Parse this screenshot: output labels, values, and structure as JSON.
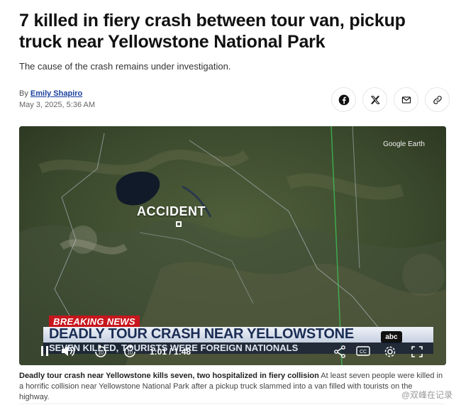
{
  "article": {
    "headline": "7 killed in fiery crash between tour van, pickup truck near Yellowstone National Park",
    "dek": "The cause of the crash remains under investigation.",
    "by_prefix": "By",
    "author": "Emily Shapiro",
    "date": "May 3, 2025, 5:36 AM"
  },
  "share": {
    "icons": [
      "facebook-icon",
      "x-icon",
      "email-icon",
      "link-icon"
    ]
  },
  "video": {
    "map_credit": "Google Earth",
    "accident_label": "ACCIDENT",
    "breaking_label": "BREAKING NEWS",
    "lower_third": "DEADLY TOUR CRASH NEAR YELLOWSTONE",
    "ticker": "SEVEN KILLED, TOURISTS WERE FOREIGN NATIONALS",
    "network_logo": "abc",
    "time_current": "1:01",
    "time_total": "1:48",
    "time_sep": " / ",
    "colors": {
      "breaking": "#c8161d",
      "lower_third_text": "#1b2d55"
    }
  },
  "caption": {
    "title": "Deadly tour crash near Yellowstone kills seven, two hospitalized in fiery collision",
    "body": "At least seven people were killed in a horrific collision near Yellowstone National Park after a pickup truck slammed into a van filled with tourists on the highway."
  },
  "watermark": "@双峰在记录"
}
